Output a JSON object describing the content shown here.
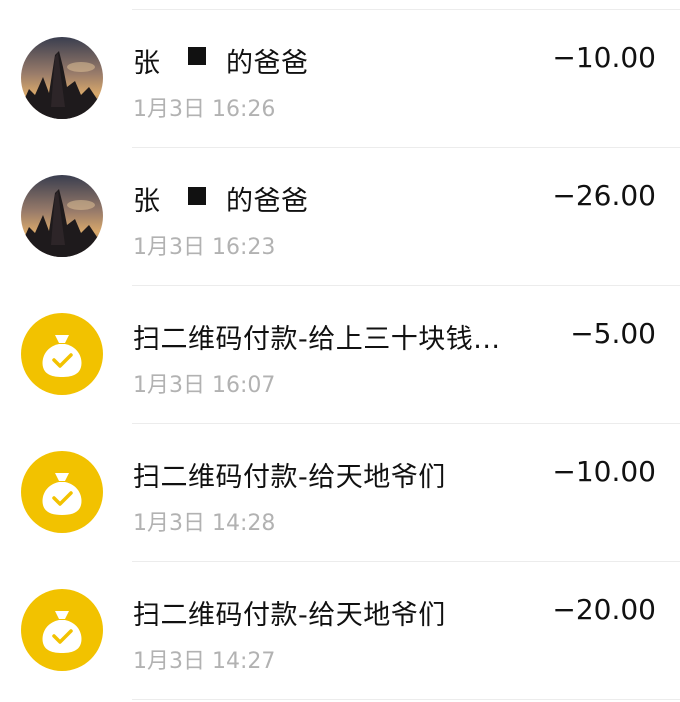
{
  "transactions": [
    {
      "title": "张",
      "title_suffix": "的爸爸",
      "time": "1月3日 16:26",
      "amount": "−10.00",
      "avatar": "landscape-avatar"
    },
    {
      "title": "张",
      "title_suffix": "的爸爸",
      "time": "1月3日 16:23",
      "amount": "−26.00",
      "avatar": "landscape-avatar"
    },
    {
      "title": "扫二维码付款-给上三十块钱...",
      "time": "1月3日 16:07",
      "amount": "−5.00",
      "avatar": "money-bag-icon"
    },
    {
      "title": "扫二维码付款-给天地爷们",
      "time": "1月3日 14:28",
      "amount": "−10.00",
      "avatar": "money-bag-icon"
    },
    {
      "title": "扫二维码付款-给天地爷们",
      "time": "1月3日 14:27",
      "amount": "−20.00",
      "avatar": "money-bag-icon"
    }
  ],
  "colors": {
    "money_bag": "#f2c200",
    "divider": "#ececec",
    "time_text": "#b2b2b2"
  }
}
